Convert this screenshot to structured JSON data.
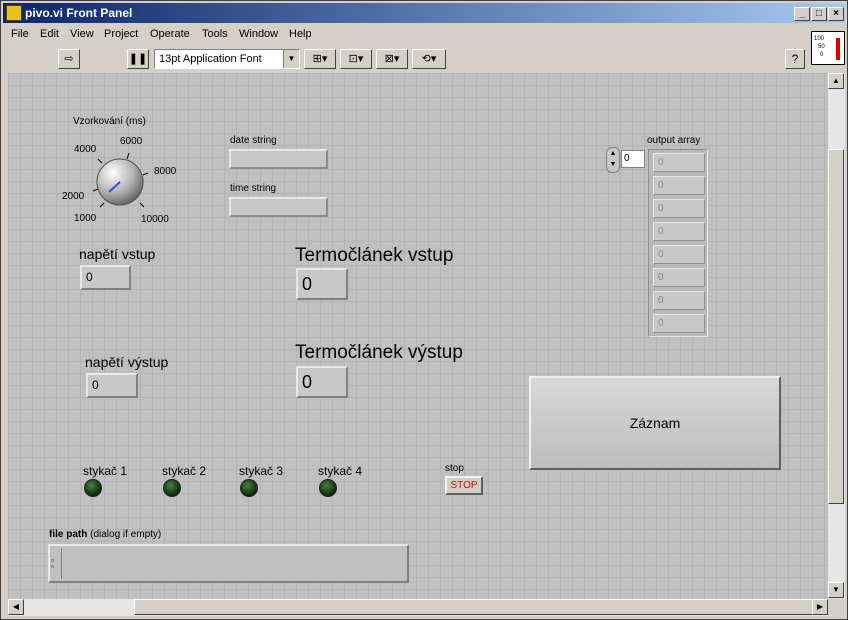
{
  "window": {
    "title": "pivo.vi Front Panel"
  },
  "menu": [
    "File",
    "Edit",
    "View",
    "Project",
    "Operate",
    "Tools",
    "Window",
    "Help"
  ],
  "toolbar": {
    "font": "13pt Application Font"
  },
  "vi_icon": {
    "labels": [
      "100",
      "50",
      "0"
    ]
  },
  "knob": {
    "label": "Vzorkování (ms)",
    "ticks": [
      "1000",
      "2000",
      "4000",
      "6000",
      "8000",
      "10000"
    ]
  },
  "date_string": {
    "label": "date string",
    "value": ""
  },
  "time_string": {
    "label": "time string",
    "value": ""
  },
  "napeti_vstup": {
    "label": "napětí vstup",
    "value": "0"
  },
  "napeti_vystup": {
    "label": "napětí výstup",
    "value": "0"
  },
  "termoclanek_vstup": {
    "label": "Termočlánek vstup",
    "value": "0"
  },
  "termoclanek_vystup": {
    "label": "Termočlánek výstup",
    "value": "0"
  },
  "output_array": {
    "label": "output array",
    "index": "0",
    "values": [
      "0",
      "0",
      "0",
      "0",
      "0",
      "0",
      "0",
      "0"
    ]
  },
  "zaznam_button": {
    "label": "Záznam"
  },
  "leds": [
    {
      "label": "stykač 1"
    },
    {
      "label": "stykač 2"
    },
    {
      "label": "stykač 3"
    },
    {
      "label": "stykač 4"
    }
  ],
  "stop": {
    "label": "stop",
    "button_text": "STOP"
  },
  "file_path": {
    "label_bold": "file path",
    "label_rest": " (dialog if empty)",
    "value": ""
  }
}
